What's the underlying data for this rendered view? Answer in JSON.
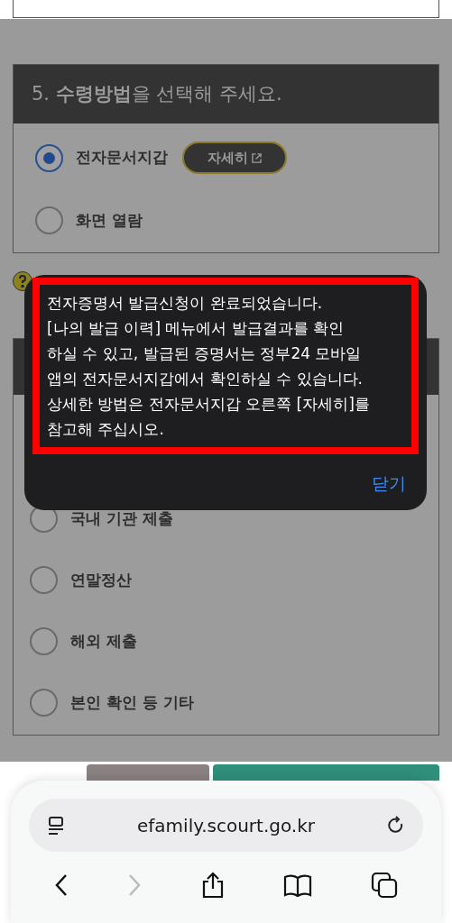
{
  "receive_section": {
    "heading": "5. **수령방법**을 선택해 주세요.",
    "options": [
      {
        "label": "전자문서지갑",
        "selected": true,
        "detail_button": "자세히"
      },
      {
        "label": "화면 열람",
        "selected": false
      }
    ]
  },
  "purpose_section": {
    "options": [
      {
        "label": "국내 기관 제출",
        "selected": false
      },
      {
        "label": "연말정산",
        "selected": false
      },
      {
        "label": "해외 제출",
        "selected": false
      },
      {
        "label": "본인 확인 등 기타",
        "selected": false
      }
    ]
  },
  "dialog": {
    "message_lines": [
      "전자증명서 발급신청이 완료되었습니다.",
      "[나의 발급 이력] 메뉴에서 발급결과를 확인",
      "하실 수 있고, 발급된 증명서는 정부24 모바일",
      "앱의 전자문서지갑에서 확인하실 수 있습니다.",
      "상세한 방법은 전자문서지갑 오른쪽 [자세히]를",
      "참고해 주십시오."
    ],
    "close_button": "닫기"
  },
  "browser": {
    "url": "efamily.scourt.go.kr"
  }
}
